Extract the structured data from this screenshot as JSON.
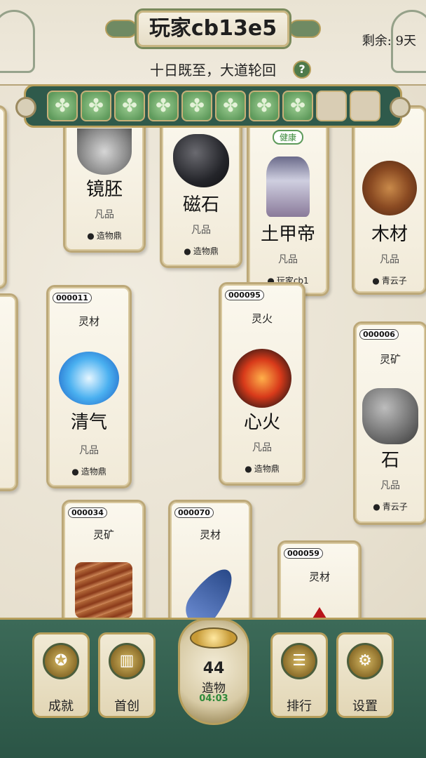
{
  "header": {
    "title": "玩家cb13e5",
    "days_left": "剩余: 9天",
    "subtitle": "十日既至，大道轮回",
    "help_icon": "?"
  },
  "slot_bar": {
    "slots_filled": 8,
    "slots_total": 10
  },
  "cards": [
    {
      "name": "镜胚",
      "grade": "凡品",
      "creator": "造物鼎",
      "art_icon": "mirror-disc-icon"
    },
    {
      "name": "磁石",
      "grade": "凡品",
      "creator": "造物鼎",
      "art_icon": "magnet-stone-icon"
    },
    {
      "name": "土甲帝",
      "grade": "凡品",
      "creator": "玩家cb1",
      "badge": "健康",
      "art_icon": "armored-emperor-icon"
    },
    {
      "name": "木材",
      "grade": "凡品",
      "creator": "青云子",
      "art_icon": "wood-log-icon"
    },
    {
      "id": "000011",
      "category": "灵材",
      "name": "清气",
      "grade": "凡品",
      "creator": "造物鼎",
      "art_icon": "blue-crystal-icon"
    },
    {
      "id": "000095",
      "category": "灵火",
      "name": "心火",
      "grade": "凡品",
      "creator": "造物鼎",
      "art_icon": "heart-fire-icon"
    },
    {
      "id": "000006",
      "category": "灵矿",
      "name": "石",
      "grade": "凡品",
      "creator": "青云子",
      "art_icon": "grey-rock-icon"
    },
    {
      "id": "000034",
      "category": "灵矿",
      "art_icon": "layered-ore-icon"
    },
    {
      "id": "000070",
      "category": "灵材",
      "art_icon": "blue-feather-icon"
    },
    {
      "id": "000059",
      "category": "灵材",
      "art_icon": "red-gem-icon"
    }
  ],
  "bottom_nav": {
    "achievements": "成就",
    "first_creation": "首创",
    "ranking": "排行",
    "settings": "设置",
    "cauldron": {
      "count": "44",
      "label": "造物",
      "timer": "04:03"
    }
  },
  "colors": {
    "accent_green": "#2f5a4b",
    "gold_border": "#b79f5c",
    "timer_green": "#2f8a3a"
  }
}
